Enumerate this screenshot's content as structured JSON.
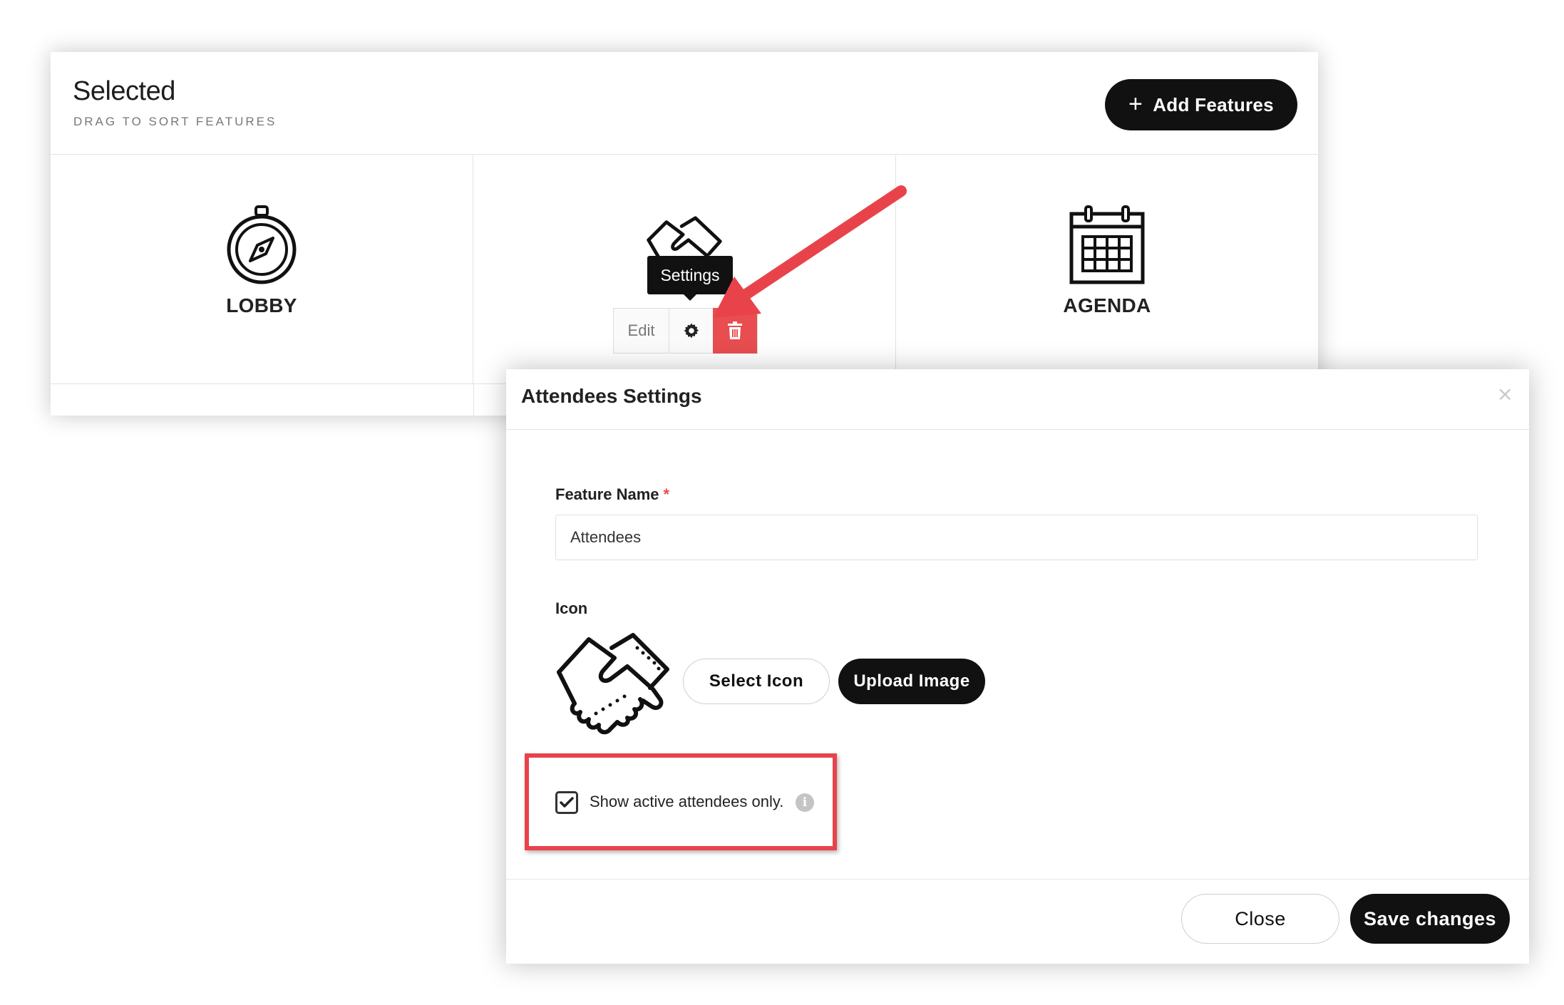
{
  "panel": {
    "title": "Selected",
    "subtitle": "DRAG TO SORT FEATURES",
    "add_button_label": "Add Features",
    "tiles": [
      {
        "label": "LOBBY",
        "icon": "compass-icon"
      },
      {
        "label": "",
        "icon": "handshake-icon"
      },
      {
        "label": "AGENDA",
        "icon": "calendar-icon"
      }
    ],
    "action_bar": {
      "edit_label": "Edit",
      "tooltip": "Settings"
    }
  },
  "modal": {
    "title": "Attendees Settings",
    "close_symbol": "×",
    "feature_name_label": "Feature Name",
    "required_mark": "*",
    "feature_name_value": "Attendees",
    "icon_label": "Icon",
    "select_icon_label": "Select Icon",
    "upload_image_label": "Upload Image",
    "checkbox_label": "Show active attendees only.",
    "checkbox_checked": true,
    "info_symbol": "i",
    "close_button_label": "Close",
    "save_button_label": "Save changes"
  },
  "colors": {
    "accent_dark": "#111111",
    "danger": "#e84d4f",
    "annotation_red": "#e8434b"
  }
}
